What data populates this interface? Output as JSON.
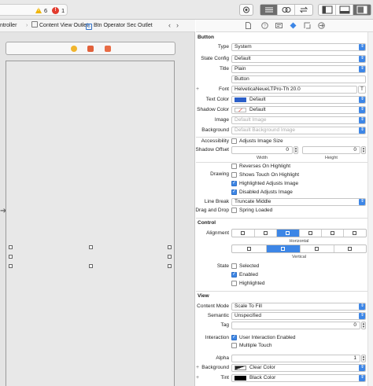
{
  "toolbar": {
    "warning_count": "6",
    "error_count": "1"
  },
  "breadcrumb": {
    "item1": "ntroller",
    "item2": "Content View Outlet",
    "item3": "Btn Operator Sec Outlet"
  },
  "inspector": {
    "button_header": "Button",
    "type_label": "Type",
    "type_value": "System",
    "state_config_label": "State Config",
    "state_config_value": "Default",
    "title_label": "Title",
    "title_style": "Plain",
    "title_text": "Button",
    "font_label": "Font",
    "font_value": "HelveticaNeueLTPro-Th 20.0",
    "text_color_label": "Text Color",
    "text_color_value": "Default",
    "shadow_color_label": "Shadow Color",
    "shadow_color_value": "Default",
    "image_label": "Image",
    "image_placeholder": "Default Image",
    "background_label": "Background",
    "background_placeholder": "Default Background Image",
    "accessibility_label": "Accessibility",
    "adjusts_image_size": "Adjusts Image Size",
    "shadow_offset_label": "Shadow Offset",
    "shadow_w": "0",
    "shadow_h": "0",
    "width_label": "Width",
    "height_label": "Height",
    "drawing_label": "Drawing",
    "reverses_on_highlight": "Reverses On Highlight",
    "shows_touch": "Shows Touch On Highlight",
    "highlighted_adjusts": "Highlighted Adjusts Image",
    "disabled_adjusts": "Disabled Adjusts Image",
    "line_break_label": "Line Break",
    "line_break_value": "Truncate Middle",
    "drag_drop_label": "Drag and Drop",
    "spring_loaded": "Spring Loaded",
    "control_header": "Control",
    "alignment_label": "Alignment",
    "horizontal_label": "Horizontal",
    "vertical_label": "Vertical",
    "state_label": "State",
    "selected": "Selected",
    "enabled": "Enabled",
    "highlighted": "Highlighted",
    "view_header": "View",
    "content_mode_label": "Content Mode",
    "content_mode_value": "Scale To Fill",
    "semantic_label": "Semantic",
    "semantic_value": "Unspecified",
    "tag_label": "Tag",
    "tag_value": "0",
    "interaction_label": "Interaction",
    "user_interaction": "User Interaction Enabled",
    "multiple_touch": "Multiple Touch",
    "alpha_label": "Alpha",
    "alpha_value": "1",
    "bg_color_label": "Background",
    "bg_color_value": "Clear Color",
    "tint_label": "Tint",
    "tint_value": "Black Color"
  },
  "colors": {
    "accent": "#3d86e6",
    "text_color_swatch": "#2c5fc9",
    "warning": "#f0b400",
    "error": "#e23b2e"
  }
}
